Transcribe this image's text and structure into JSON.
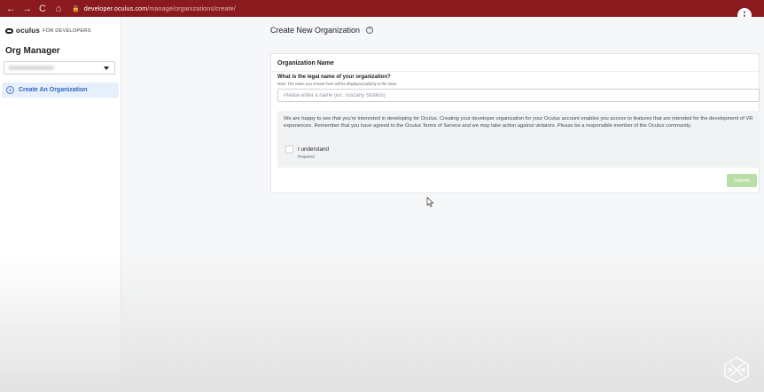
{
  "browser": {
    "url_host": "developer.oculus.com",
    "url_path": "/manage/organizations/create/",
    "back_glyph": "←",
    "forward_glyph": "→",
    "reload_glyph": "C",
    "home_glyph": "⌂",
    "menu_glyph": "⋮",
    "lock_glyph": "🔒"
  },
  "sidebar": {
    "logo_text": "oculus",
    "logo_sub": "FOR DEVELOPERS",
    "title": "Org Manager",
    "items": [
      {
        "label": "Create An Organization",
        "icon": "plus-circle-icon",
        "active": true
      }
    ],
    "plus_glyph": "+"
  },
  "main": {
    "title": "Create New Organization",
    "help_glyph": "?",
    "card": {
      "heading": "Organization Name",
      "question": "What is the legal name of your organization?",
      "note": "Note: The name you choose here will be displayed publicly in the store.",
      "input_value": "",
      "input_placeholder": "Please enter a name (ex: Tuscany Studios)",
      "notice": "We are happy to see that you're interested in developing for Oculus. Creating your developer organization for your Oculus account enables you access to features that are intended for the development of VR experiences. Remember that you have agreed to the Oculus Terms of Service and we may take action against violators. Please be a responsible member of the Oculus community.",
      "checkbox_label": "I understand",
      "checkbox_required": "Required",
      "submit_label": "Submit"
    }
  },
  "colors": {
    "browser_bar": "#8a1a1d",
    "accent_blue": "#2d67c4",
    "active_item_bg": "#e7f0fa",
    "submit_disabled": "#b8dfa6"
  }
}
